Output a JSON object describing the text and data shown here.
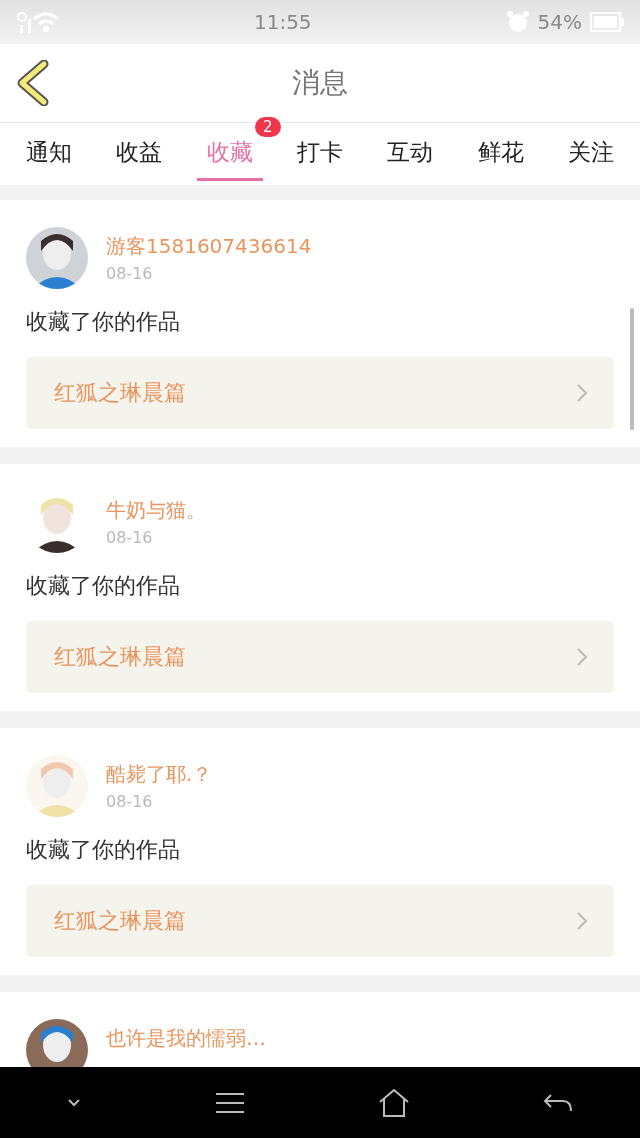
{
  "status_bar": {
    "time": "11:55",
    "battery": "54%"
  },
  "header": {
    "title": "消息"
  },
  "tabs": [
    {
      "label": "通知",
      "selected": false
    },
    {
      "label": "收益",
      "selected": false
    },
    {
      "label": "收藏",
      "selected": true,
      "badge": "2"
    },
    {
      "label": "打卡",
      "selected": false
    },
    {
      "label": "互动",
      "selected": false
    },
    {
      "label": "鲜花",
      "selected": false
    },
    {
      "label": "关注",
      "selected": false
    }
  ],
  "messages": [
    {
      "user": "游客1581607436614",
      "date": "08-16",
      "action": "收藏了你的作品",
      "work": "红狐之琳晨篇"
    },
    {
      "user": "牛奶与猫。",
      "date": "08-16",
      "action": "收藏了你的作品",
      "work": "红狐之琳晨篇"
    },
    {
      "user": "酷毙了耶.？",
      "date": "08-16",
      "action": "收藏了你的作品",
      "work": "红狐之琳晨篇"
    },
    {
      "user": "也许是我的懦弱…"
    }
  ]
}
